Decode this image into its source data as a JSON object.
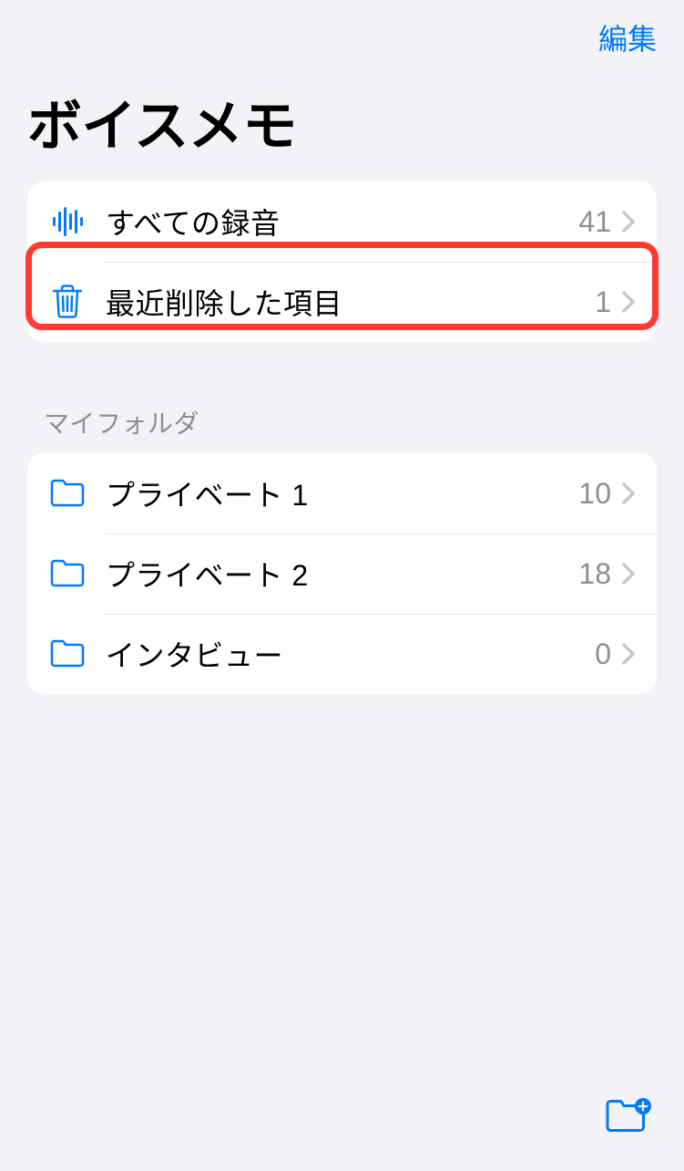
{
  "header": {
    "edit_label": "編集"
  },
  "title": "ボイスメモ",
  "system_folders": [
    {
      "icon": "waveform",
      "label": "すべての録音",
      "count": "41"
    },
    {
      "icon": "trash",
      "label": "最近削除した項目",
      "count": "1"
    }
  ],
  "my_folders_header": "マイフォルダ",
  "my_folders": [
    {
      "icon": "folder",
      "label": "プライベート 1",
      "count": "10"
    },
    {
      "icon": "folder",
      "label": "プライベート 2",
      "count": "18"
    },
    {
      "icon": "folder",
      "label": "インタビュー",
      "count": "0"
    }
  ],
  "colors": {
    "accent": "#007aff",
    "highlight": "#ff3b30"
  }
}
